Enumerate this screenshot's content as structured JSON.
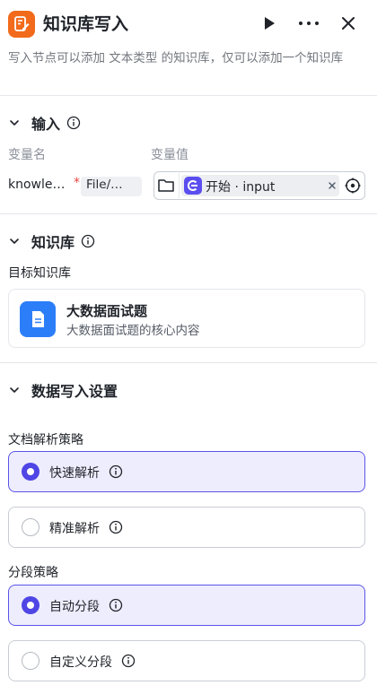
{
  "header": {
    "title": "知识库写入",
    "description": "写入节点可以添加 文本类型 的知识库，仅可以添加一个知识库"
  },
  "input_section": {
    "title": "输入",
    "col_name": "变量名",
    "col_value": "变量值",
    "variable_name": "knowle…",
    "required_mark": "*",
    "variable_type": "File/…",
    "value_ref": "开始 · input"
  },
  "kb_section": {
    "title": "知识库",
    "target_label": "目标知识库",
    "kb_name": "大数据面试题",
    "kb_desc": "大数据面试题的核心内容"
  },
  "write_section": {
    "title": "数据写入设置",
    "parse_label": "文档解析策略",
    "parse_options": [
      {
        "label": "快速解析",
        "selected": true
      },
      {
        "label": "精准解析",
        "selected": false
      }
    ],
    "split_label": "分段策略",
    "split_options": [
      {
        "label": "自动分段",
        "selected": true
      },
      {
        "label": "自定义分段",
        "selected": false
      }
    ]
  },
  "colors": {
    "brand_orange": "#f26a1b",
    "accent_purple": "#4f46e5",
    "kb_blue": "#2c7ef8"
  }
}
